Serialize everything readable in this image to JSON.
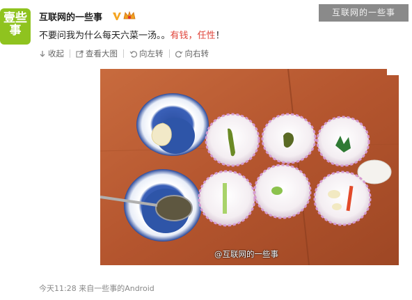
{
  "user": {
    "avatar_line1": "壹些",
    "avatar_line2": "事",
    "name": "互联网的一些事"
  },
  "top_watermark": "互联网的一些事",
  "post": {
    "text_part1": "不要问我为什么每天六菜一汤。。",
    "text_red1": "有钱",
    "text_comma": "，",
    "text_red2": "任性",
    "text_end": "！"
  },
  "actions": {
    "collapse": "收起",
    "view_large": "查看大图",
    "rotate_left": "向左转",
    "rotate_right": "向右转"
  },
  "photo": {
    "watermark": "@互联网的一些事"
  },
  "footer": {
    "time": "今天11:28",
    "source": "来自一些事的Android"
  },
  "colors": {
    "accent_red": "#e0443a",
    "avatar_green": "#8fc31f",
    "table_wood": "#b95d35"
  }
}
